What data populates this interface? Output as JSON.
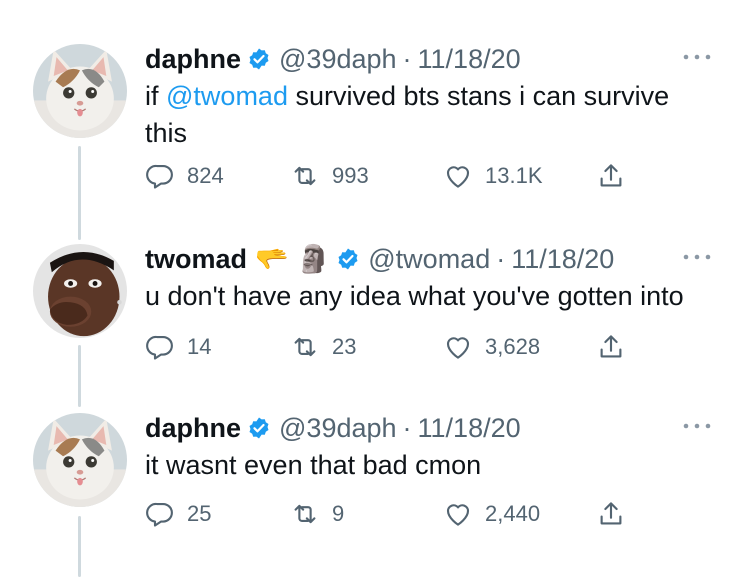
{
  "tweets": [
    {
      "name": "daphne",
      "handle": "@39daph",
      "separator": "·",
      "date": "11/18/20",
      "text_mention": "",
      "text": "if ",
      "mention": "@twomad",
      "text_after": " survived bts stans i can survive this",
      "counts": {
        "replies": "824",
        "retweets": "993",
        "likes": "13.1K"
      },
      "avatar_icon": "white-cat-avatar"
    },
    {
      "name": "twomad",
      "emojis": [
        "🫳",
        "🗿"
      ],
      "handle": "@twomad",
      "separator": "·",
      "date": "11/18/20",
      "text": "u don't have any idea what you've gotten into",
      "counts": {
        "replies": "14",
        "retweets": "23",
        "likes": "3,628"
      },
      "avatar_icon": "person-avatar"
    },
    {
      "name": "daphne",
      "handle": "@39daph",
      "separator": "·",
      "date": "11/18/20",
      "text": "it wasnt even that bad cmon",
      "counts": {
        "replies": "25",
        "retweets": "9",
        "likes": "2,440"
      },
      "avatar_icon": "white-cat-avatar"
    }
  ],
  "colors": {
    "text": "#0f1419",
    "secondary": "#536471",
    "accent": "#1d9bf0",
    "thread_line": "#cfd9de"
  },
  "icons": [
    "verified-badge-icon",
    "more-icon",
    "reply-icon",
    "retweet-icon",
    "like-icon",
    "share-icon"
  ]
}
